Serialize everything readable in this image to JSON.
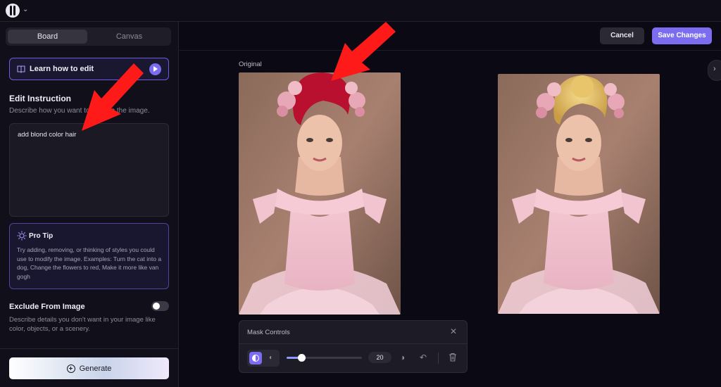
{
  "topbar": {
    "chevron": "⌄"
  },
  "sidebar": {
    "tabs": [
      {
        "label": "Board"
      },
      {
        "label": "Canvas"
      }
    ],
    "learn": {
      "label": "Learn how to edit"
    },
    "edit": {
      "title": "Edit Instruction",
      "subtitle": "Describe how you want to change the image.",
      "value": "add blond color hair"
    },
    "tip": {
      "title": "Pro Tip",
      "body": "Try adding, removing, or thinking of styles you could use to modify the image. Examples: Turn the cat into a dog, Change the flowers to red, Make it more like van gogh"
    },
    "exclude": {
      "title": "Exclude From Image",
      "subtitle": "Describe details you don't want in your image like color, objects, or a scenery.",
      "enabled": false
    },
    "generate_label": "Generate"
  },
  "toolbar": {
    "cancel_label": "Cancel",
    "save_label": "Save Changes"
  },
  "expand": {
    "chevron": "›"
  },
  "canvas": {
    "original_label": "Original"
  },
  "mask": {
    "title": "Mask Controls",
    "close": "✕",
    "brush_size": 20,
    "brush_max": 100
  },
  "colors": {
    "accent": "#7b6cf0",
    "arrow": "#ff1a1a",
    "mask_hair": "#b8102e",
    "edited_hair": "#e8c46a"
  },
  "icons": [
    "book-icon",
    "play-icon",
    "sparkle-icon",
    "plus-circle-icon",
    "chevron-right-icon",
    "close-icon",
    "invert-icon",
    "undo-icon",
    "trash-icon"
  ]
}
